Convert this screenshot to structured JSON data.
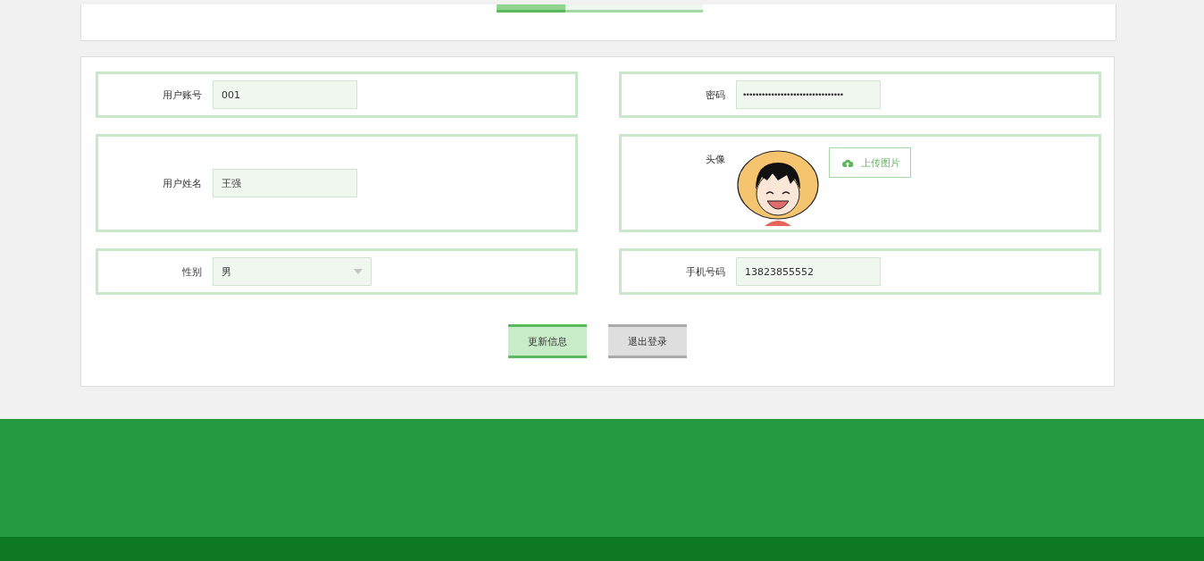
{
  "fields": [
    {
      "kind": "text",
      "label": "用户账号",
      "value": "001"
    },
    {
      "kind": "password",
      "label": "密码",
      "value": "••••••••••••••••••••••••••••••••"
    },
    {
      "kind": "text",
      "label": "用户姓名",
      "value": "王强"
    },
    {
      "kind": "avatar",
      "label": "头像",
      "button": "上传图片"
    },
    {
      "kind": "select",
      "label": "性别",
      "value": "男"
    },
    {
      "kind": "text",
      "label": "手机号码",
      "value": "13823855552"
    }
  ],
  "buttons": [
    {
      "kind": "primary",
      "label": "更新信息"
    },
    {
      "kind": "secondary",
      "label": "退出登录"
    }
  ]
}
